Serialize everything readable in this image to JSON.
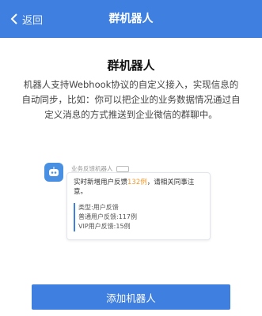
{
  "nav": {
    "back_label": "返回",
    "title": "群机器人"
  },
  "content": {
    "title": "群机器人",
    "description": "机器人支持Webhook协议的自定义接入，实现信息的自动同步，比如：你可以把企业的业务数据情况通过自定义消息的方式推送到企业微信的群聊中。"
  },
  "preview": {
    "sender": "业务反馈机器人",
    "message_prefix": "实时新增用户反馈",
    "message_highlight": "132例",
    "message_suffix": "，请相关同事注意。",
    "details": [
      "类型:用户反馈",
      "普通用户反馈:117例",
      "VIP用户反馈:15例"
    ]
  },
  "button": {
    "label": "添加机器人"
  },
  "colors": {
    "primary": "#3f7fe0",
    "highlight": "#f39a2e"
  },
  "icons": {
    "back": "chevron-left-icon",
    "avatar": "robot-icon"
  }
}
